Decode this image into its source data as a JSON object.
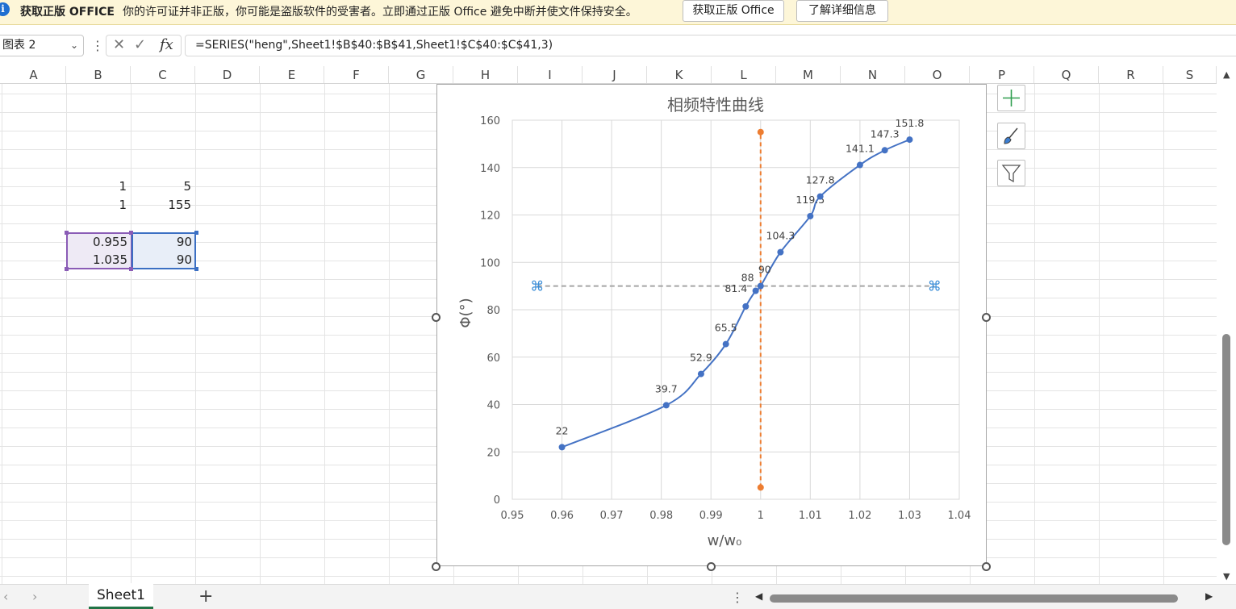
{
  "warning_bar": {
    "title": "获取正版 OFFICE",
    "message": "你的许可证并非正版，你可能是盗版软件的受害者。立即通过正版 Office 避免中断并使文件保持安全。",
    "get_genuine_button": "获取正版 Office",
    "learn_more_button": "了解详细信息"
  },
  "formula_bar": {
    "name_box": "图表 2",
    "fx_label": "fx",
    "formula": "=SERIES(\"heng\",Sheet1!$B$40:$B$41,Sheet1!$C$40:$C$41,3)"
  },
  "columns": [
    "A",
    "B",
    "C",
    "D",
    "E",
    "F",
    "G",
    "H",
    "I",
    "J",
    "K",
    "L",
    "M",
    "N",
    "O",
    "P",
    "Q",
    "R",
    "S"
  ],
  "cells": {
    "b1": "1",
    "c1": "5",
    "b2": "1",
    "c2": "155",
    "b3": "0.955",
    "c3": "90",
    "b4": "1.035",
    "c4": "90"
  },
  "sheet_tabs": {
    "active": "Sheet1",
    "add": "+"
  },
  "icons": {
    "info": "info-icon",
    "cancel": "cancel-icon",
    "enter": "check-icon",
    "chart_elements": "plus-icon",
    "chart_styles": "brush-icon",
    "chart_filters": "filter-icon"
  },
  "colors": {
    "series_main": "#4472c4",
    "series_vertical": "#ed7d31",
    "series_horizontal": "#a5a5a5",
    "accent": "#217346"
  },
  "chart_data": {
    "type": "scatter",
    "title": "相频特性曲线",
    "xlabel": "w/w₀",
    "ylabel": "Φ(°)",
    "xlim": [
      0.95,
      1.04
    ],
    "ylim": [
      0,
      160
    ],
    "xticks": [
      "0.95",
      "0.96",
      "0.97",
      "0.98",
      "0.99",
      "1",
      "1.01",
      "1.02",
      "1.03",
      "1.04"
    ],
    "yticks": [
      "0",
      "20",
      "40",
      "60",
      "80",
      "100",
      "120",
      "140",
      "160"
    ],
    "grid": true,
    "series": [
      {
        "style": "smooth-line-markers",
        "color": "#4472c4",
        "x": [
          0.96,
          0.981,
          0.988,
          0.993,
          0.997,
          0.999,
          1.0,
          1.004,
          1.01,
          1.012,
          1.02,
          1.025,
          1.03
        ],
        "y": [
          22,
          39.7,
          52.9,
          65.5,
          81.4,
          88,
          90,
          104.3,
          119.5,
          127.8,
          141.1,
          147.3,
          151.8
        ],
        "labels": [
          "22",
          "39.7",
          "52.9",
          "65.5",
          "81.4",
          "88",
          "90",
          "104.3",
          "119.5",
          "127.8",
          "141.1",
          "147.3",
          "151.8"
        ]
      },
      {
        "style": "dashed-markers",
        "color": "#ed7d31",
        "x": [
          1,
          1
        ],
        "y": [
          5,
          155
        ]
      },
      {
        "name": "heng",
        "style": "dashed",
        "color": "#a5a5a5",
        "x": [
          0.955,
          1.035
        ],
        "y": [
          90,
          90
        ]
      }
    ]
  }
}
